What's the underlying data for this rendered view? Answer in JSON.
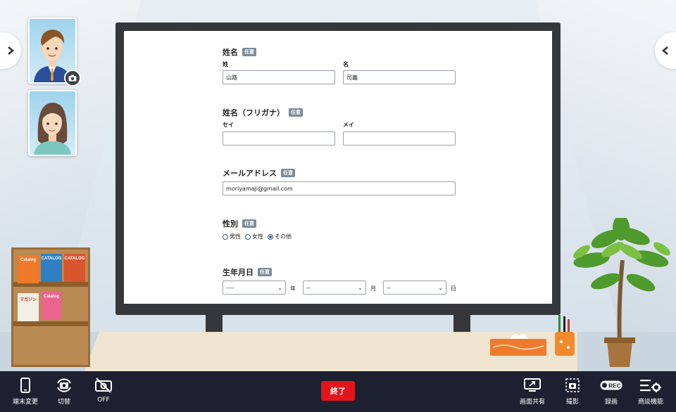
{
  "form": {
    "name": {
      "title": "姓名",
      "badge": "任意",
      "last_label": "姓",
      "last_value": "山路",
      "first_label": "名",
      "first_value": "司義"
    },
    "kana": {
      "title": "姓名（フリガナ）",
      "badge": "任意",
      "last_label": "セイ",
      "last_value": "",
      "first_label": "メイ",
      "first_value": ""
    },
    "email": {
      "title": "メールアドレス",
      "badge": "任意",
      "value": "moriyamaji@gmail.com"
    },
    "gender": {
      "title": "性別",
      "badge": "任意",
      "options": [
        "男性",
        "女性",
        "その他"
      ],
      "selected": "その他"
    },
    "birthday": {
      "title": "生年月日",
      "badge": "任意",
      "year_value": "----",
      "year_unit": "年",
      "month_value": "--",
      "month_unit": "月",
      "day_value": "--",
      "day_unit": "日"
    }
  },
  "room": {
    "books": [
      "Catalog",
      "CATALOG",
      "CATALOG",
      "マガジン",
      "Catalog"
    ]
  },
  "toolbar": {
    "device_change": "端末変更",
    "switch": "切替",
    "camera_off": "OFF",
    "end": "終了",
    "screen_share": "画面共有",
    "capture": "撮影",
    "record": "録画",
    "rec_badge": "REC",
    "meeting_features": "商談機能"
  },
  "colors": {
    "end_button": "#e4141b",
    "toolbar_bg": "#1d2030",
    "badge": "#7a8a9a"
  }
}
